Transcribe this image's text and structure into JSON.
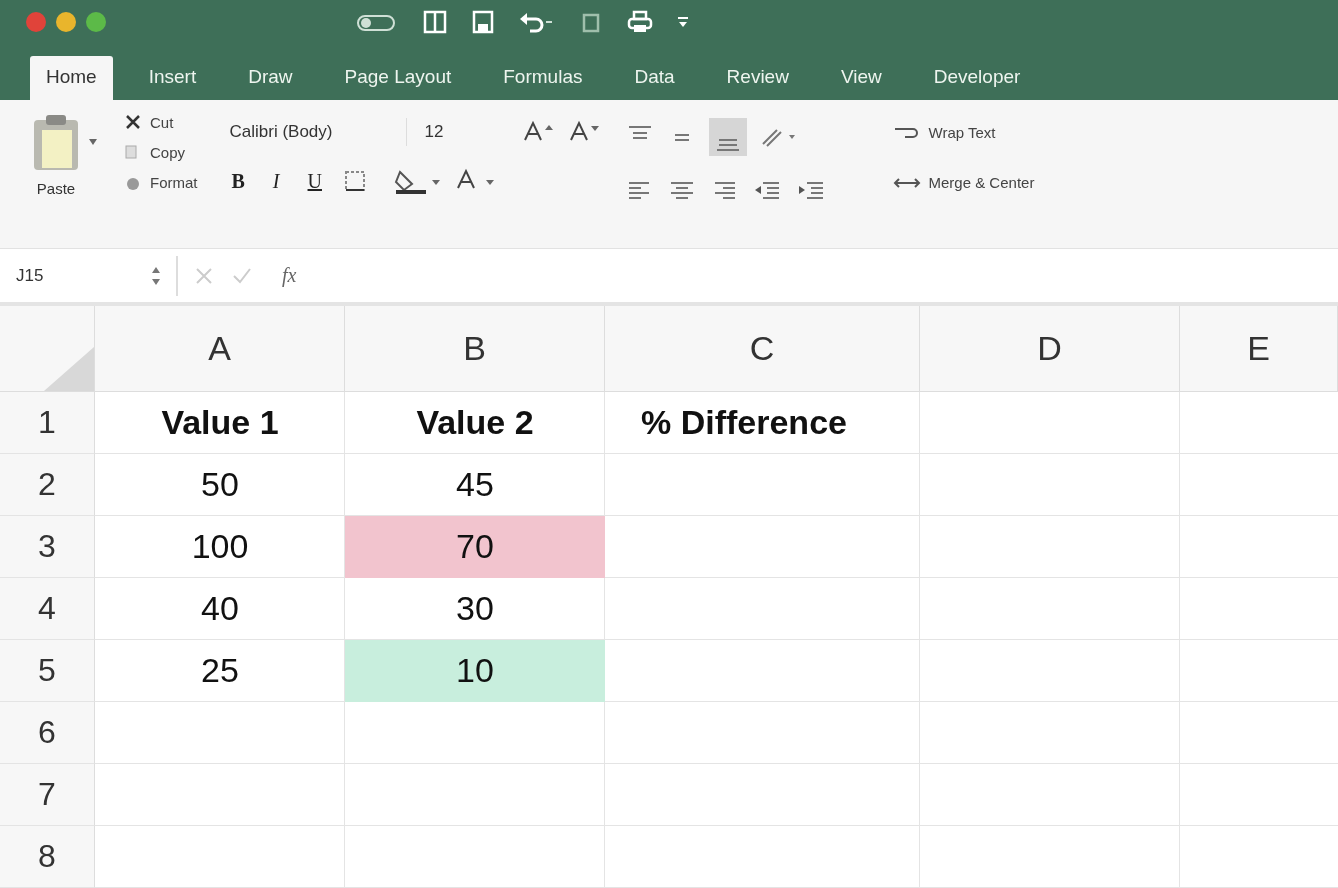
{
  "tabs": [
    {
      "label": "Home",
      "selected": true
    },
    {
      "label": "Insert",
      "selected": false
    },
    {
      "label": "Draw",
      "selected": false
    },
    {
      "label": "Page Layout",
      "selected": false
    },
    {
      "label": "Formulas",
      "selected": false
    },
    {
      "label": "Data",
      "selected": false
    },
    {
      "label": "Review",
      "selected": false
    },
    {
      "label": "View",
      "selected": false
    },
    {
      "label": "Developer",
      "selected": false
    }
  ],
  "clipboard": {
    "paste": "Paste",
    "cut": "Cut",
    "copy": "Copy",
    "format": "Format"
  },
  "font": {
    "family": "Calibri (Body)",
    "size": "12",
    "bold": "B",
    "italic": "I",
    "underline": "U"
  },
  "alignment": {
    "wrap": "Wrap Text",
    "merge": "Merge & Center"
  },
  "formula_bar": {
    "name_box": "J15",
    "fx": "fx"
  },
  "columns": [
    "A",
    "B",
    "C",
    "D",
    "E"
  ],
  "rows": [
    {
      "number": "1",
      "cells": [
        {
          "text": "Value 1",
          "bold": true
        },
        {
          "text": "Value 2",
          "bold": true
        },
        {
          "text": "% Difference",
          "bold": true
        }
      ]
    },
    {
      "number": "2",
      "cells": [
        {
          "text": "50",
          "bold": false
        },
        {
          "text": "45",
          "bold": false
        }
      ]
    },
    {
      "number": "3",
      "cells": [
        {
          "text": "100",
          "bold": false
        },
        {
          "text": "70",
          "bold": false,
          "color": "#f2c4ce"
        }
      ]
    },
    {
      "number": "4",
      "cells": [
        {
          "text": "40",
          "bold": false
        },
        {
          "text": "30",
          "bold": false
        }
      ]
    },
    {
      "number": "5",
      "cells": [
        {
          "text": "25",
          "bold": false
        },
        {
          "text": "10",
          "bold": false,
          "color": "#c8eedd"
        }
      ]
    },
    {
      "number": "6",
      "cells": []
    },
    {
      "number": "7",
      "cells": []
    },
    {
      "number": "8",
      "cells": []
    }
  ]
}
